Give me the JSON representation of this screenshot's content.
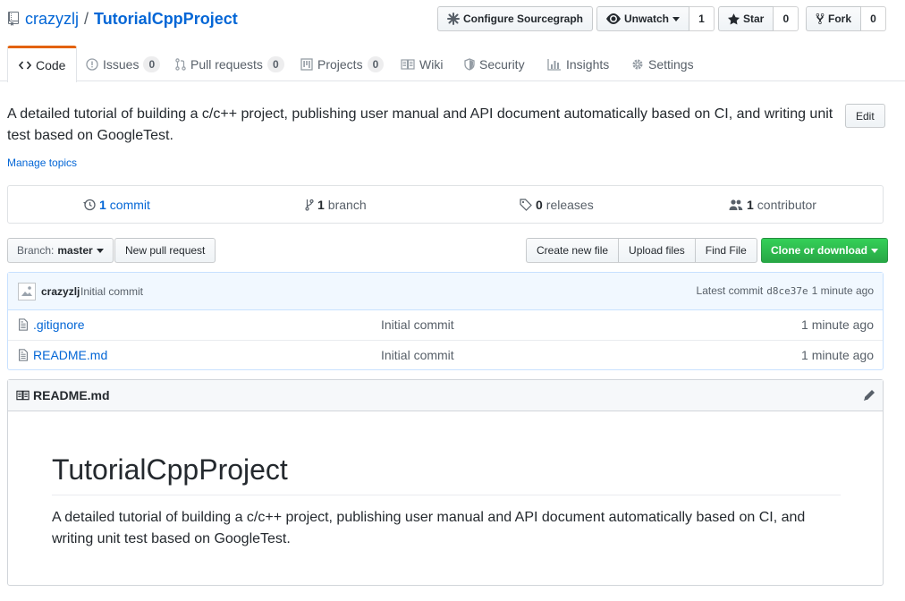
{
  "repo": {
    "owner": "crazyzlj",
    "separator": "/",
    "name": "TutorialCppProject"
  },
  "header_actions": {
    "sourcegraph_label": "Configure Sourcegraph",
    "watch_label": "Unwatch",
    "watch_count": "1",
    "star_label": "Star",
    "star_count": "0",
    "fork_label": "Fork",
    "fork_count": "0"
  },
  "tabs": [
    {
      "label": "Code",
      "count": null,
      "icon": "code-icon",
      "selected": true
    },
    {
      "label": "Issues",
      "count": "0",
      "icon": "issue-icon"
    },
    {
      "label": "Pull requests",
      "count": "0",
      "icon": "pull-request-icon"
    },
    {
      "label": "Projects",
      "count": "0",
      "icon": "project-icon"
    },
    {
      "label": "Wiki",
      "count": null,
      "icon": "book-icon"
    },
    {
      "label": "Security",
      "count": null,
      "icon": "shield-icon"
    },
    {
      "label": "Insights",
      "count": null,
      "icon": "graph-icon"
    },
    {
      "label": "Settings",
      "count": null,
      "icon": "gear-icon"
    }
  ],
  "description": "A detailed tutorial of building a c/c++ project, publishing user manual and API document automatically based on CI, and writing unit test based on GoogleTest.",
  "edit_label": "Edit",
  "manage_topics": "Manage topics",
  "summary": {
    "commits_num": "1",
    "commits_label": "commit",
    "branches_num": "1",
    "branches_label": "branch",
    "releases_num": "0",
    "releases_label": "releases",
    "contributors_num": "1",
    "contributors_label": "contributor"
  },
  "file_nav": {
    "branch_prefix": "Branch:",
    "branch_name": "master",
    "new_pr": "New pull request",
    "create_file": "Create new file",
    "upload_files": "Upload files",
    "find_file": "Find File",
    "clone": "Clone or download"
  },
  "latest_commit": {
    "author": "crazyzlj",
    "message": "Initial commit",
    "prefix": "Latest commit",
    "sha": "d8ce37e",
    "age": "1 minute ago"
  },
  "files": [
    {
      "name": ".gitignore",
      "message": "Initial commit",
      "age": "1 minute ago"
    },
    {
      "name": "README.md",
      "message": "Initial commit",
      "age": "1 minute ago"
    }
  ],
  "readme": {
    "filename": "README.md",
    "title": "TutorialCppProject",
    "body": "A detailed tutorial of building a c/c++ project, publishing user manual and API document automatically based on CI, and writing unit test based on GoogleTest."
  },
  "colors": {
    "link": "#0366d6",
    "tab_accent": "#e36209",
    "clone_button": "#28a745",
    "commit_tease_bg": "#f1f8ff"
  }
}
